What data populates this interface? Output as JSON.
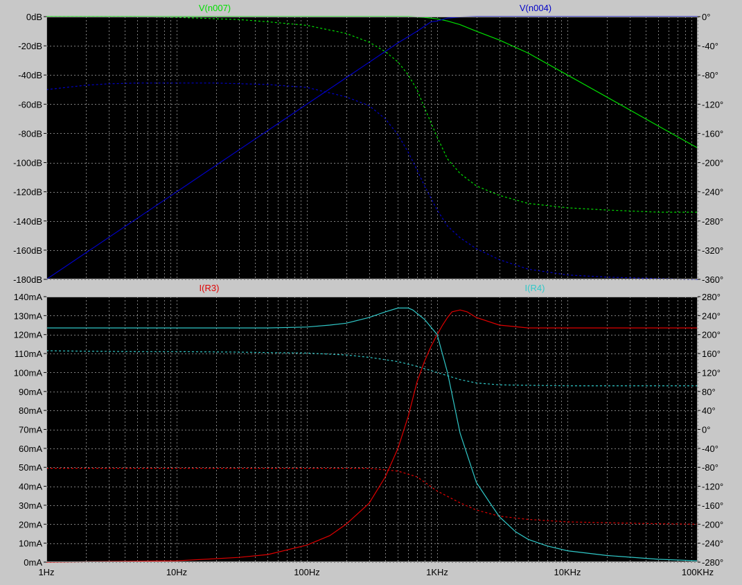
{
  "app": {
    "background_color": "#000000",
    "frame_color": "#c8c8c8",
    "grid_color": "#808080",
    "axis_text_color": "#000000",
    "grid": true,
    "x_axis": "log"
  },
  "chart_data": [
    {
      "type": "line",
      "xlim": [
        1,
        100000
      ],
      "ylim": [
        -180,
        0
      ],
      "y2lim": [
        -360,
        0
      ],
      "x_ticks": [
        {
          "value": 1,
          "label": "1Hz"
        },
        {
          "value": 10,
          "label": "10Hz"
        },
        {
          "value": 100,
          "label": "100Hz"
        },
        {
          "value": 1000,
          "label": "1KHz"
        },
        {
          "value": 10000,
          "label": "10KHz"
        },
        {
          "value": 100000,
          "label": "100KHz"
        }
      ],
      "y_ticks": [
        {
          "value": 0,
          "label": "0dB"
        },
        {
          "value": -20,
          "label": "-20dB"
        },
        {
          "value": -40,
          "label": "-40dB"
        },
        {
          "value": -60,
          "label": "-60dB"
        },
        {
          "value": -80,
          "label": "-80dB"
        },
        {
          "value": -100,
          "label": "-100dB"
        },
        {
          "value": -120,
          "label": "-120dB"
        },
        {
          "value": -140,
          "label": "-140dB"
        },
        {
          "value": -160,
          "label": "-160dB"
        },
        {
          "value": -180,
          "label": "-180dB"
        }
      ],
      "y2_ticks": [
        {
          "value": 0,
          "label": "0°"
        },
        {
          "value": -40,
          "label": "-40°"
        },
        {
          "value": -80,
          "label": "-80°"
        },
        {
          "value": -120,
          "label": "-120°"
        },
        {
          "value": -160,
          "label": "-160°"
        },
        {
          "value": -200,
          "label": "-200°"
        },
        {
          "value": -240,
          "label": "-240°"
        },
        {
          "value": -280,
          "label": "-280°"
        },
        {
          "value": -320,
          "label": "-320°"
        },
        {
          "value": -360,
          "label": "-360°"
        }
      ],
      "series": [
        {
          "name": "V(n007)",
          "color": "#00e000",
          "magnitude": {
            "x": [
              1,
              5,
              10,
              30,
              100,
              200,
              400,
              600,
              800,
              1000,
              1200,
              1500,
              2000,
              3000,
              5000,
              10000,
              20000,
              50000,
              100000
            ],
            "y": [
              0,
              0,
              0,
              0,
              0,
              0,
              0,
              0,
              -0.5,
              -1.5,
              -3,
              -5.5,
              -10,
              -16,
              -25,
              -40,
              -55,
              -75,
              -90
            ]
          },
          "phase": {
            "x": [
              1,
              5,
              10,
              30,
              50,
              100,
              200,
              300,
              400,
              500,
              600,
              700,
              800,
              1000,
              1200,
              1500,
              2000,
              3000,
              5000,
              10000,
              20000,
              50000,
              100000
            ],
            "y": [
              0,
              0,
              -1,
              -4,
              -7,
              -12,
              -23,
              -35,
              -48,
              -62,
              -80,
              -100,
              -125,
              -165,
              -195,
              -215,
              -232,
              -245,
              -256,
              -262,
              -265,
              -268,
              -268
            ]
          }
        },
        {
          "name": "V(n004)",
          "color": "#0000c8",
          "magnitude": {
            "x": [
              1,
              10,
              100,
              500,
              700,
              800,
              900,
              1000,
              1200,
              1500,
              2000,
              5000,
              10000,
              100000
            ],
            "y": [
              -180,
              -120,
              -60,
              -18,
              -10,
              -6.5,
              -3.5,
              -3,
              -1,
              -0.3,
              0,
              0,
              0,
              0
            ]
          },
          "phase": {
            "x": [
              1,
              2,
              3,
              5,
              10,
              20,
              50,
              100,
              200,
              300,
              400,
              500,
              600,
              700,
              800,
              1000,
              1200,
              1500,
              2000,
              3000,
              5000,
              10000,
              20000,
              50000,
              100000
            ],
            "y": [
              -100,
              -94,
              -92,
              -91,
              -91,
              -91,
              -93,
              -97,
              -110,
              -122,
              -140,
              -162,
              -186,
              -210,
              -232,
              -265,
              -287,
              -303,
              -318,
              -333,
              -346,
              -354,
              -357,
              -359,
              -360
            ]
          }
        }
      ],
      "labels": [
        {
          "text": "V(n007)",
          "color": "#00e000"
        },
        {
          "text": "V(n004)",
          "color": "#0000c8"
        }
      ]
    },
    {
      "type": "line",
      "xlim": [
        1,
        100000
      ],
      "ylim": [
        0,
        140
      ],
      "y2lim": [
        -280,
        280
      ],
      "x_ticks": [
        {
          "value": 1,
          "label": "1Hz"
        },
        {
          "value": 10,
          "label": "10Hz"
        },
        {
          "value": 100,
          "label": "100Hz"
        },
        {
          "value": 1000,
          "label": "1KHz"
        },
        {
          "value": 10000,
          "label": "10KHz"
        },
        {
          "value": 100000,
          "label": "100KHz"
        }
      ],
      "y_ticks": [
        {
          "value": 140,
          "label": "140mA"
        },
        {
          "value": 130,
          "label": "130mA"
        },
        {
          "value": 120,
          "label": "120mA"
        },
        {
          "value": 110,
          "label": "110mA"
        },
        {
          "value": 100,
          "label": "100mA"
        },
        {
          "value": 90,
          "label": "90mA"
        },
        {
          "value": 80,
          "label": "80mA"
        },
        {
          "value": 70,
          "label": "70mA"
        },
        {
          "value": 60,
          "label": "60mA"
        },
        {
          "value": 50,
          "label": "50mA"
        },
        {
          "value": 40,
          "label": "40mA"
        },
        {
          "value": 30,
          "label": "30mA"
        },
        {
          "value": 20,
          "label": "20mA"
        },
        {
          "value": 10,
          "label": "10mA"
        },
        {
          "value": 0,
          "label": "0mA"
        }
      ],
      "y2_ticks": [
        {
          "value": 280,
          "label": "280°"
        },
        {
          "value": 240,
          "label": "240°"
        },
        {
          "value": 200,
          "label": "200°"
        },
        {
          "value": 160,
          "label": "160°"
        },
        {
          "value": 120,
          "label": "120°"
        },
        {
          "value": 80,
          "label": "80°"
        },
        {
          "value": 40,
          "label": "40°"
        },
        {
          "value": 0,
          "label": "0°"
        },
        {
          "value": -40,
          "label": "-40°"
        },
        {
          "value": -80,
          "label": "-80°"
        },
        {
          "value": -120,
          "label": "-120°"
        },
        {
          "value": -160,
          "label": "-160°"
        },
        {
          "value": -200,
          "label": "-200°"
        },
        {
          "value": -240,
          "label": "-240°"
        },
        {
          "value": -280,
          "label": "-280°"
        }
      ],
      "series": [
        {
          "name": "I(R3)",
          "color": "#e00000",
          "magnitude": {
            "x": [
              1,
              10,
              30,
              50,
              100,
              150,
              200,
              300,
              400,
              500,
              600,
              700,
              800,
              900,
              1000,
              1100,
              1200,
              1300,
              1500,
              1700,
              2000,
              3000,
              5000,
              10000,
              100000
            ],
            "y": [
              0,
              0.7,
              2.5,
              4,
              9,
              14,
              20,
              31,
              45,
              60,
              77,
              95,
              106,
              114,
              120,
              125,
              129,
              132,
              133,
              132,
              129,
              125,
              123.5,
              123.5,
              123.5
            ]
          },
          "phase": {
            "x": [
              1,
              5,
              10,
              50,
              100,
              200,
              300,
              500,
              700,
              1000,
              1500,
              2000,
              3000,
              5000,
              10000,
              20000,
              50000,
              100000
            ],
            "y": [
              -82,
              -82,
              -82,
              -82,
              -82,
              -82,
              -82,
              -88,
              -100,
              -130,
              -155,
              -170,
              -183,
              -190,
              -195,
              -197,
              -199,
              -200
            ]
          }
        },
        {
          "name": "I(R4)",
          "color": "#30c8c8",
          "magnitude": {
            "x": [
              1,
              10,
              50,
              100,
              150,
              200,
              300,
              400,
              500,
              600,
              650,
              800,
              1000,
              1200,
              1500,
              2000,
              2500,
              3000,
              4000,
              5000,
              7000,
              10000,
              20000,
              50000,
              100000
            ],
            "y": [
              123.5,
              123.5,
              123.5,
              124,
              125,
              126,
              129,
              132,
              134,
              134,
              133,
              128,
              120,
              100,
              68,
              42,
              32,
              24,
              16,
              12,
              8.5,
              6,
              3.5,
              1.5,
              0.7
            ]
          },
          "phase": {
            "x": [
              1,
              2,
              5,
              10,
              30,
              50,
              100,
              200,
              300,
              500,
              700,
              1000,
              1500,
              2000,
              3000,
              5000,
              10000,
              50000,
              100000
            ],
            "y": [
              166,
              165,
              164,
              164,
              163,
              162,
              161,
              157,
              152,
              143,
              133,
              120,
              105,
              98,
              94,
              93,
              92,
              92,
              92
            ]
          }
        }
      ],
      "labels": [
        {
          "text": "I(R3)",
          "color": "#e00000"
        },
        {
          "text": "I(R4)",
          "color": "#30c8c8"
        }
      ]
    }
  ]
}
